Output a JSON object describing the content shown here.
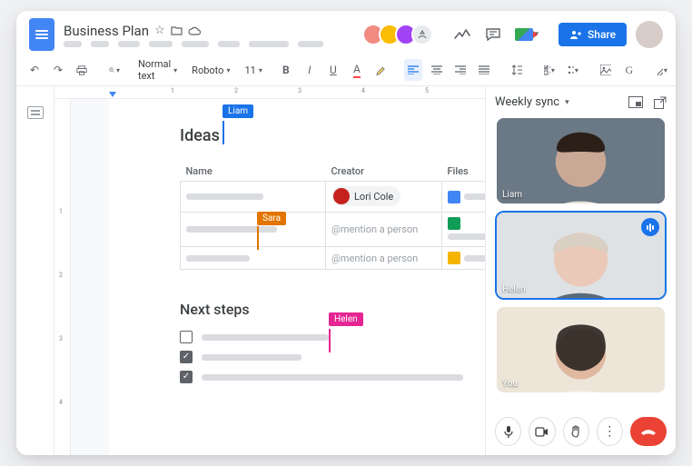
{
  "doc": {
    "title": "Business Plan",
    "headings": {
      "ideas": "Ideas",
      "next_steps": "Next steps"
    },
    "table": {
      "headers": {
        "name": "Name",
        "creator": "Creator",
        "files": "Files"
      },
      "rows": [
        {
          "creator_name": "Lori Cole",
          "mention_placeholder": "",
          "file_type": "docs"
        },
        {
          "creator_name": "",
          "mention_placeholder": "@mention a person",
          "file_type": "sheets"
        },
        {
          "creator_name": "",
          "mention_placeholder": "@mention a person",
          "file_type": "slides"
        }
      ]
    },
    "cursors": {
      "liam": {
        "label": "Liam",
        "color": "#1a73e8"
      },
      "sara": {
        "label": "Sara",
        "color": "#e37400"
      },
      "helen": {
        "label": "Helen",
        "color": "#e52592"
      }
    }
  },
  "toolbar": {
    "style_select": "Normal text",
    "font_select": "Roboto",
    "size_select": "11"
  },
  "share": {
    "label": "Share"
  },
  "meet": {
    "title": "Weekly sync",
    "tiles": [
      {
        "name": "Liam",
        "speaking": false
      },
      {
        "name": "Helen",
        "speaking": true
      },
      {
        "name": "You",
        "speaking": false
      }
    ]
  },
  "icons": {
    "star": "☆",
    "folder": "⠀",
    "cloud": "☁",
    "undo": "↶",
    "redo": "↷",
    "print": "🖶",
    "trend": "📈",
    "comment": "💬",
    "caret": "▾",
    "pip": "⧉",
    "popout": "⭷",
    "mic": "🎤",
    "video": "🎥",
    "hand": "✋",
    "more": "⋮",
    "hangup": "📞"
  },
  "colors": {
    "docs": "#4285f4",
    "sheets": "#0f9d58",
    "slides": "#f4b400"
  }
}
